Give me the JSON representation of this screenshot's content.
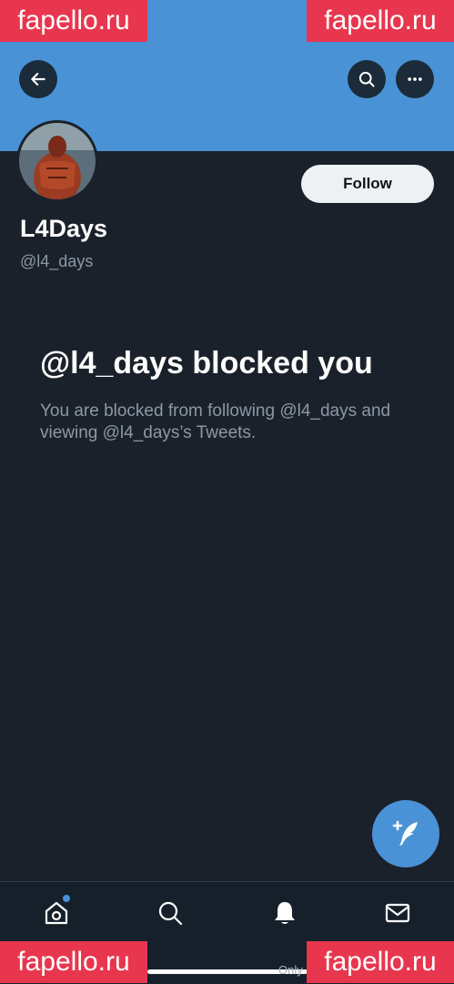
{
  "watermarks": {
    "text": "fapello.ru"
  },
  "header": {
    "back_icon": "arrow-left-icon",
    "search_icon": "search-icon",
    "more_icon": "more-horizontal-icon"
  },
  "profile": {
    "display_name": "L4Days",
    "handle": "@l4_days",
    "follow_label": "Follow"
  },
  "blocked": {
    "title": "@l4_days blocked you",
    "description": "You are blocked from following @l4_days and viewing @l4_days’s Tweets."
  },
  "compose": {
    "icon": "compose-tweet-icon"
  },
  "tabbar": {
    "items": [
      {
        "name": "home",
        "icon": "home-icon",
        "has_dot": true
      },
      {
        "name": "search",
        "icon": "search-icon"
      },
      {
        "name": "notifications",
        "icon": "bell-icon",
        "active": true
      },
      {
        "name": "messages",
        "icon": "mail-icon"
      }
    ]
  },
  "bottom_text": "Only",
  "colors": {
    "banner": "#4a92d6",
    "background": "#1b212a",
    "accent": "#4a92d6",
    "watermark": "#e8364f"
  }
}
